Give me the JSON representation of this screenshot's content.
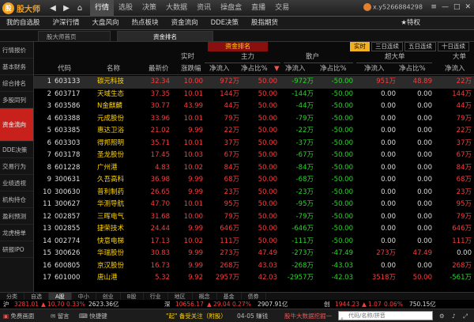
{
  "app": {
    "logo_text": "股大师",
    "logo_badge": "股"
  },
  "nav": {
    "back": "◀",
    "forward": "▶",
    "home": "⌂"
  },
  "top_menu": [
    "行情",
    "选股",
    "决策",
    "大数据",
    "资讯",
    "操盘盒",
    "直播",
    "交易"
  ],
  "user": {
    "name": "x.y5266884298"
  },
  "window_buttons": [
    "≡",
    "—",
    "□",
    "✕"
  ],
  "sub_menu": [
    "我的自选股",
    "沪深行情",
    "大盘风向",
    "热点板块",
    "资金流向",
    "DDE决策",
    "股指期货"
  ],
  "special_label": "★特权",
  "page_tabs": [
    "股大师首页",
    "资金排名"
  ],
  "sidebar": [
    "行情报价",
    "基本财务",
    "综合排名",
    "多股同列",
    "资金流向",
    "DDE决策",
    "交易行为",
    "业绩透视",
    "机构持仓",
    "盈利预测",
    "龙虎榜单",
    "研报IPO"
  ],
  "sidebar_active": 4,
  "banner_title": "资金排名",
  "filters": [
    "实时",
    "三日连续",
    "五日连续",
    "十日连续"
  ],
  "header_groups": {
    "realtime": "实时",
    "main_force": "主力",
    "retail": "散户",
    "super_big": "超大单",
    "big": "大单"
  },
  "headers": {
    "code": "代码",
    "name": "名称",
    "price": "最新价",
    "change": "涨跌幅",
    "main_in": "净流入",
    "main_ratio": "净占比%",
    "ret_in": "净流入",
    "ret_ratio": "净占比%",
    "sb_in": "净流入",
    "sb_ratio": "净占比%",
    "big_in": "净流入"
  },
  "rows": [
    {
      "idx": "1",
      "code": "603133",
      "name": "碳元科技",
      "price": "32.34",
      "change": "10.00",
      "main_in": "972万",
      "main_ratio": "50.00",
      "ret_in": "-972万",
      "ret_ratio": "-50.00",
      "sb_in": "951万",
      "sb_ratio": "48.89",
      "big_in": "22万"
    },
    {
      "idx": "2",
      "code": "603717",
      "name": "天域生态",
      "price": "37.35",
      "change": "10.01",
      "main_in": "144万",
      "main_ratio": "50.00",
      "ret_in": "-144万",
      "ret_ratio": "-50.00",
      "sb_in": "0.00",
      "sb_ratio": "0.00",
      "big_in": "144万"
    },
    {
      "idx": "3",
      "code": "603586",
      "name": "N金麒麟",
      "price": "30.77",
      "change": "43.99",
      "main_in": "44万",
      "main_ratio": "50.00",
      "ret_in": "-44万",
      "ret_ratio": "-50.00",
      "sb_in": "0.00",
      "sb_ratio": "0.00",
      "big_in": "44万"
    },
    {
      "idx": "4",
      "code": "603388",
      "name": "元成股份",
      "price": "33.96",
      "change": "10.01",
      "main_in": "79万",
      "main_ratio": "50.00",
      "ret_in": "-79万",
      "ret_ratio": "-50.00",
      "sb_in": "0.00",
      "sb_ratio": "0.00",
      "big_in": "79万"
    },
    {
      "idx": "5",
      "code": "603385",
      "name": "惠达卫浴",
      "price": "21.02",
      "change": "9.99",
      "main_in": "22万",
      "main_ratio": "50.00",
      "ret_in": "-22万",
      "ret_ratio": "-50.00",
      "sb_in": "0.00",
      "sb_ratio": "0.00",
      "big_in": "22万"
    },
    {
      "idx": "6",
      "code": "603303",
      "name": "得邦照明",
      "price": "35.71",
      "change": "10.01",
      "main_in": "37万",
      "main_ratio": "50.00",
      "ret_in": "-37万",
      "ret_ratio": "-50.00",
      "sb_in": "0.00",
      "sb_ratio": "0.00",
      "big_in": "37万"
    },
    {
      "idx": "7",
      "code": "603178",
      "name": "圣龙股份",
      "price": "17.45",
      "change": "10.03",
      "main_in": "67万",
      "main_ratio": "50.00",
      "ret_in": "-67万",
      "ret_ratio": "-50.00",
      "sb_in": "0.00",
      "sb_ratio": "0.00",
      "big_in": "67万"
    },
    {
      "idx": "8",
      "code": "601228",
      "name": "广州港",
      "price": "4.83",
      "change": "10.02",
      "main_in": "84万",
      "main_ratio": "50.00",
      "ret_in": "-84万",
      "ret_ratio": "-50.00",
      "sb_in": "0.00",
      "sb_ratio": "0.00",
      "big_in": "84万"
    },
    {
      "idx": "9",
      "code": "300631",
      "name": "久吾高科",
      "price": "36.98",
      "change": "9.99",
      "main_in": "68万",
      "main_ratio": "50.00",
      "ret_in": "-68万",
      "ret_ratio": "-50.00",
      "sb_in": "0.00",
      "sb_ratio": "0.00",
      "big_in": "68万"
    },
    {
      "idx": "10",
      "code": "300630",
      "name": "普利制药",
      "price": "26.65",
      "change": "9.99",
      "main_in": "23万",
      "main_ratio": "50.00",
      "ret_in": "-23万",
      "ret_ratio": "-50.00",
      "sb_in": "0.00",
      "sb_ratio": "0.00",
      "big_in": "23万"
    },
    {
      "idx": "11",
      "code": "300627",
      "name": "华测导航",
      "price": "47.70",
      "change": "10.01",
      "main_in": "95万",
      "main_ratio": "50.00",
      "ret_in": "-95万",
      "ret_ratio": "-50.00",
      "sb_in": "0.00",
      "sb_ratio": "0.00",
      "big_in": "95万"
    },
    {
      "idx": "12",
      "code": "002857",
      "name": "三晖电气",
      "price": "31.68",
      "change": "10.00",
      "main_in": "79万",
      "main_ratio": "50.00",
      "ret_in": "-79万",
      "ret_ratio": "-50.00",
      "sb_in": "0.00",
      "sb_ratio": "0.00",
      "big_in": "79万"
    },
    {
      "idx": "13",
      "code": "002855",
      "name": "捷荣技术",
      "price": "24.44",
      "change": "9.99",
      "main_in": "646万",
      "main_ratio": "50.00",
      "ret_in": "-646万",
      "ret_ratio": "-50.00",
      "sb_in": "0.00",
      "sb_ratio": "0.00",
      "big_in": "646万"
    },
    {
      "idx": "14",
      "code": "002774",
      "name": "快意电梯",
      "price": "17.13",
      "change": "10.02",
      "main_in": "111万",
      "main_ratio": "50.00",
      "ret_in": "-111万",
      "ret_ratio": "-50.00",
      "sb_in": "0.00",
      "sb_ratio": "0.00",
      "big_in": "111万"
    },
    {
      "idx": "15",
      "code": "300626",
      "name": "华瑞股份",
      "price": "30.83",
      "change": "9.99",
      "main_in": "273万",
      "main_ratio": "47.49",
      "ret_in": "-273万",
      "ret_ratio": "-47.49",
      "sb_in": "273万",
      "sb_ratio": "47.49",
      "big_in": "0.00"
    },
    {
      "idx": "16",
      "code": "600805",
      "name": "京汉股份",
      "price": "16.73",
      "change": "9.99",
      "main_in": "268万",
      "main_ratio": "43.03",
      "ret_in": "-268万",
      "ret_ratio": "-43.03",
      "sb_in": "0.00",
      "sb_ratio": "0.00",
      "big_in": "268万"
    },
    {
      "idx": "17",
      "code": "601000",
      "name": "唐山港",
      "price": "5.32",
      "change": "9.92",
      "main_in": "2957万",
      "main_ratio": "42.03",
      "ret_in": "-2957万",
      "ret_ratio": "-42.03",
      "sb_in": "3518万",
      "sb_ratio": "50.00",
      "big_in": "-561万"
    }
  ],
  "bottom_tabs": [
    "分类",
    "自选",
    "A股",
    "中小",
    "创业",
    "B股",
    "行业",
    "地区",
    "概念",
    "基金",
    "债券"
  ],
  "bottom_active": 2,
  "index_bar": {
    "sh_label": "沪",
    "sh_value": "3281.01",
    "sh_arrow": "▲",
    "sh_change": "10.70",
    "sh_pct": "0.33%",
    "sh_amount": "2623.36亿",
    "sz_label": "深",
    "sz_value": "10656.17",
    "sz_arrow": "▲",
    "sz_change": "29.04",
    "sz_pct": "0.27%",
    "sz_amount": "2907.91亿",
    "cy_label": "创",
    "cy_value": "1944.23",
    "cy_arrow": "▲",
    "cy_change": "1.07",
    "cy_pct": "0.06%",
    "cy_amount": "750.15亿"
  },
  "status": {
    "free_trade": "免费画面",
    "message": "留言",
    "shortcut": "快捷键",
    "ticker": "\"起\" 备受关注（附股）",
    "time": "04-05 赚钱",
    "ad": "股牛大数据挖掘一",
    "search_placeholder": "代码/名称/拼音"
  }
}
